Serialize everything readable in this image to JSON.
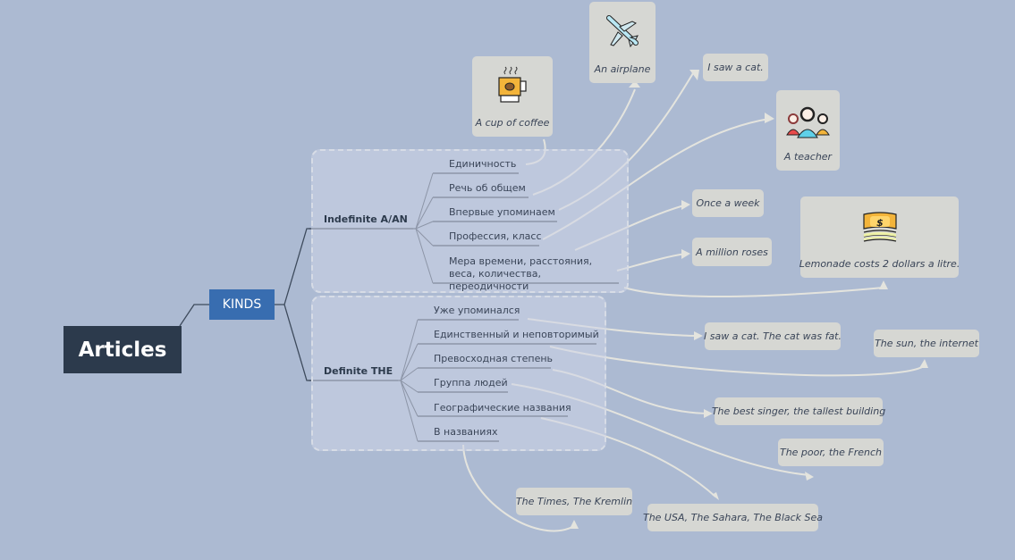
{
  "root": {
    "label": "Articles"
  },
  "kinds": {
    "label": "KINDS"
  },
  "branches": [
    {
      "label": "Indefinite A/AN",
      "items": [
        {
          "label": "Единичность",
          "example": "A cup of coffee",
          "icon": "coffee-cup-icon"
        },
        {
          "label": "Речь об общем",
          "example": "An airplane",
          "icon": "airplane-icon"
        },
        {
          "label": "Впервые упоминаем",
          "example": "I saw a cat."
        },
        {
          "label": "Профессия, класс",
          "example": "A teacher",
          "icon": "people-icon"
        },
        {
          "label": "Мера времени, расстояния, веса, количества, переодичности",
          "examples": [
            "Once a week",
            "A million roses",
            "Lemonade costs 2 dollars a litre."
          ],
          "icon": "money-icon"
        }
      ]
    },
    {
      "label": "Definite THE",
      "items": [
        {
          "label": "Уже упоминался",
          "example": "I saw a cat. The cat was fat."
        },
        {
          "label": "Единственный и неповторимый",
          "example": "The sun, the internet"
        },
        {
          "label": "Превосходная степень",
          "example": "The best singer, the tallest building"
        },
        {
          "label": "Группа людей",
          "example": "The poor, the French"
        },
        {
          "label": "Географические названия",
          "example": "The USA, The Sahara, The Black Sea"
        },
        {
          "label": "В названиях",
          "example": "The Times, The Kremlin"
        }
      ]
    }
  ],
  "colors": {
    "background": "#acbad2",
    "root": "#2c3a4c",
    "kinds": "#386db0",
    "card": "#d6d7d3",
    "connector": "#e4e4de"
  }
}
